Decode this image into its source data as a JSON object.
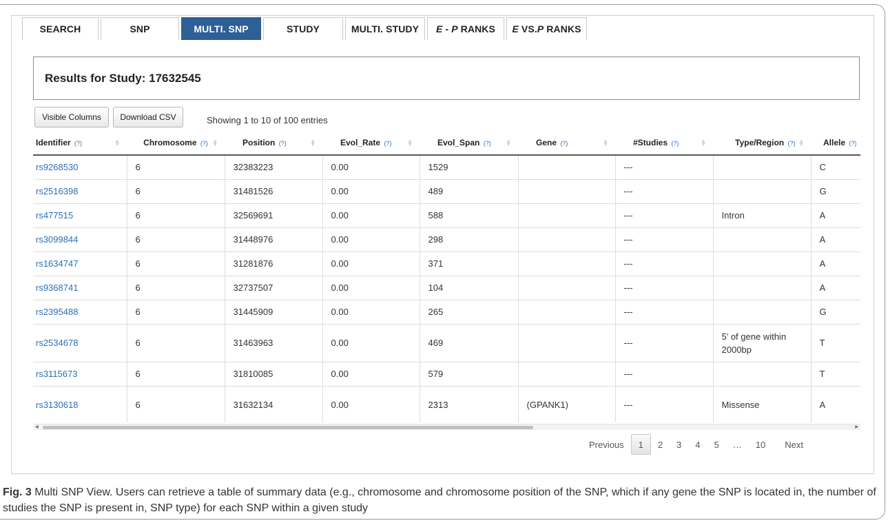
{
  "tabs": [
    {
      "label": "SEARCH",
      "active": false
    },
    {
      "label": "SNP",
      "active": false
    },
    {
      "label": "MULTI. SNP",
      "active": true
    },
    {
      "label": "STUDY",
      "active": false
    },
    {
      "label": "MULTI. STUDY",
      "active": false
    },
    {
      "italic": "E",
      "rest": " - ",
      "italic2": "P",
      "rest2": " RANKS",
      "active": false
    },
    {
      "italic": "E",
      "rest": " VS.",
      "italic2": "P",
      "rest2": " RANKS",
      "active": false
    }
  ],
  "results": {
    "title": "Results for Study: 17632545"
  },
  "toolbar": {
    "visible_columns_label": "Visible Columns",
    "download_csv_label": "Download CSV",
    "entries_info": "Showing 1 to 10 of 100 entries"
  },
  "table": {
    "help_text": "(?)",
    "columns": [
      "Identifier",
      "Chromosome",
      "Position",
      "Evol_Rate",
      "Evol_Span",
      "Gene",
      "#Studies",
      "Type/Region",
      "Allele"
    ],
    "rows": [
      {
        "id": "rs9268530",
        "chrom": "6",
        "pos": "32383223",
        "rate": "0.00",
        "span": "1529",
        "gene": "",
        "studies": "---",
        "type": "",
        "allele": "C"
      },
      {
        "id": "rs2516398",
        "chrom": "6",
        "pos": "31481526",
        "rate": "0.00",
        "span": "489",
        "gene": "",
        "studies": "---",
        "type": "",
        "allele": "G"
      },
      {
        "id": "rs477515",
        "chrom": "6",
        "pos": "32569691",
        "rate": "0.00",
        "span": "588",
        "gene": "",
        "studies": "---",
        "type": "Intron",
        "allele": "A"
      },
      {
        "id": "rs3099844",
        "chrom": "6",
        "pos": "31448976",
        "rate": "0.00",
        "span": "298",
        "gene": "",
        "studies": "---",
        "type": "",
        "allele": "A"
      },
      {
        "id": "rs1634747",
        "chrom": "6",
        "pos": "31281876",
        "rate": "0.00",
        "span": "371",
        "gene": "",
        "studies": "---",
        "type": "",
        "allele": "A"
      },
      {
        "id": "rs9368741",
        "chrom": "6",
        "pos": "32737507",
        "rate": "0.00",
        "span": "104",
        "gene": "",
        "studies": "---",
        "type": "",
        "allele": "A"
      },
      {
        "id": "rs2395488",
        "chrom": "6",
        "pos": "31445909",
        "rate": "0.00",
        "span": "265",
        "gene": "",
        "studies": "---",
        "type": "",
        "allele": "G"
      },
      {
        "id": "rs2534678",
        "chrom": "6",
        "pos": "31463963",
        "rate": "0.00",
        "span": "469",
        "gene": "",
        "studies": "---",
        "type": "5' of gene within 2000bp",
        "allele": "T"
      },
      {
        "id": "rs3115673",
        "chrom": "6",
        "pos": "31810085",
        "rate": "0.00",
        "span": "579",
        "gene": "",
        "studies": "---",
        "type": "",
        "allele": "T"
      },
      {
        "id": "rs3130618",
        "chrom": "6",
        "pos": "31632134",
        "rate": "0.00",
        "span": "2313",
        "gene": "(GPANK1)",
        "studies": "---",
        "type": "Missense",
        "allele": "A"
      }
    ]
  },
  "pagination": {
    "previous": "Previous",
    "pages": [
      "1",
      "2",
      "3",
      "4",
      "5",
      "…",
      "10"
    ],
    "current": "1",
    "next": "Next"
  },
  "caption": {
    "label": "Fig. 3",
    "text": " Multi SNP View. Users can retrieve a table of summary data (e.g., chromosome and chromosome position of the SNP, which if any gene the SNP is located in, the number of studies the SNP is present in, SNP type) for each SNP within a given study"
  },
  "colors": {
    "accent": "#2e5f97",
    "link": "#2a6fb8"
  }
}
